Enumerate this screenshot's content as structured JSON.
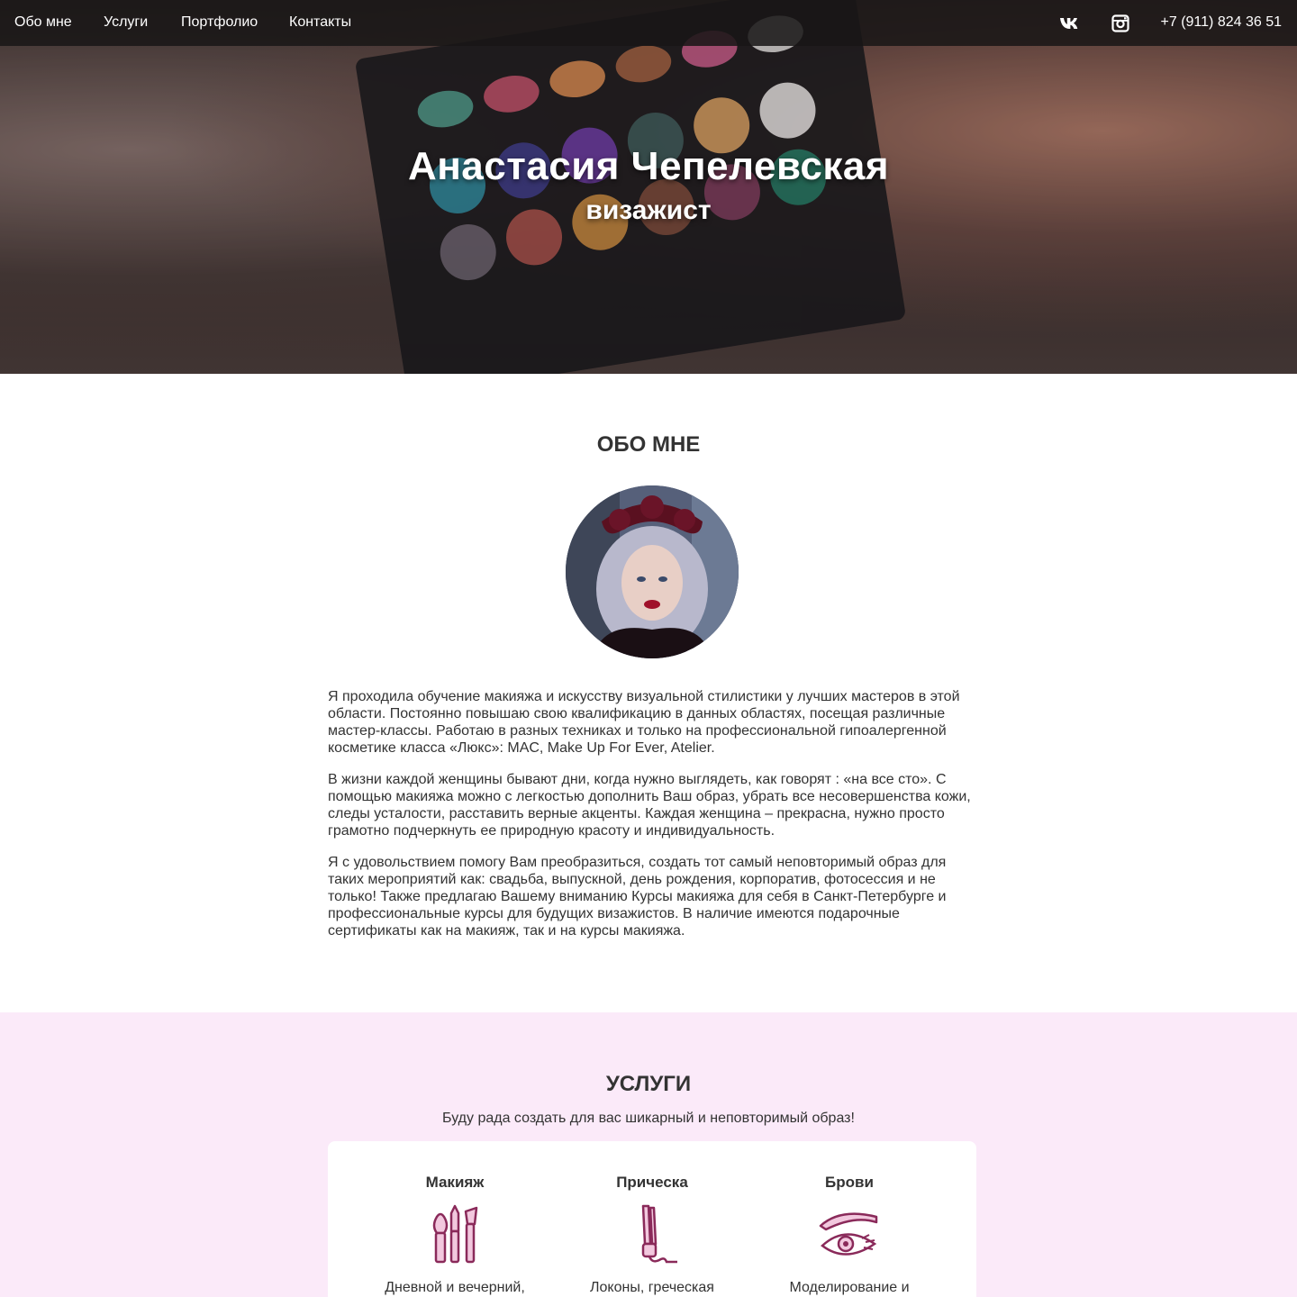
{
  "nav": {
    "items": [
      "Обо мне",
      "Услуги",
      "Портфолио",
      "Контакты"
    ],
    "vk_icon": "vk-icon",
    "instagram_icon": "instagram-icon",
    "phone": "+7 (911) 824 36 51"
  },
  "hero": {
    "title": "Анастасия Чепелевская",
    "subtitle": "визажист"
  },
  "about": {
    "title": "ОБО МНЕ",
    "paragraphs": [
      "Я проходила обучение макияжа и искусству визуальной стилистики у лучших мастеров в этой области. Постоянно повышаю свою квалификацию в данных областях, посещая различные мастер-классы. Работаю в разных техниках и только на профессиональной гипоалергенной косметике класса «Люкс»: MAC, Make Up For Ever, Atelier.",
      "В жизни каждой женщины бывают дни, когда нужно выглядеть, как говорят : «на все сто». С помощью макияжа можно с легкостью дополнить Ваш образ, убрать все несовершенства кожи, следы усталости, расставить верные акценты. Каждая женщина – прекрасна, нужно просто грамотно подчеркнуть ее природную красоту и индивидуальность.",
      "Я с удовольствием помогу Вам преобразиться, создать тот самый неповторимый образ для таких мероприятий как: свадьба, выпускной, день рождения, корпоратив, фотосессия и не только! Также предлагаю Вашему вниманию Курсы макияжа для себя в Санкт-Петербурге и профессиональные курсы для будущих визажистов. В наличие имеются подарочные сертификаты как на макияж, так и на курсы макияжа."
    ]
  },
  "services": {
    "title": "УСЛУГИ",
    "subtitle": "Буду рада создать для вас шикарный и неповторимый образ!",
    "items": [
      {
        "name": "Макияж",
        "icon": "makeup-brushes-icon",
        "desc": "Дневной и вечерний,"
      },
      {
        "name": "Прическа",
        "icon": "hair-straightener-icon",
        "desc": "Локоны, греческая"
      },
      {
        "name": "Брови",
        "icon": "eyebrow-eye-icon",
        "desc": "Моделирование и"
      }
    ]
  },
  "colors": {
    "accent": "#c0457f",
    "services_bg": "#fbeaf9",
    "nav_bg": "#1f1b1b"
  }
}
